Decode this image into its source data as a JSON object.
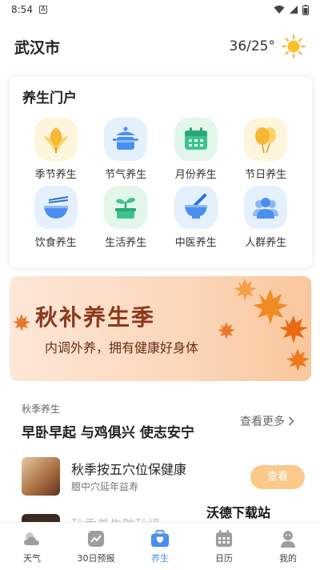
{
  "status_bar": {
    "time": "8:54",
    "notification_letter": "A"
  },
  "header": {
    "city": "武汉市",
    "temperature": "36/25°",
    "weather_icon": "sun-icon"
  },
  "portal": {
    "title": "养生门户",
    "items": [
      {
        "label": "季节养生",
        "icon": "leaf-icon",
        "bg": "#fff4dc"
      },
      {
        "label": "节气养生",
        "icon": "pot-icon",
        "bg": "#e4f0fc"
      },
      {
        "label": "月份养生",
        "icon": "calendar-icon",
        "bg": "#e2f6ec"
      },
      {
        "label": "节日养生",
        "icon": "balloons-icon",
        "bg": "#fff4dc"
      },
      {
        "label": "饮食养生",
        "icon": "bowl-icon",
        "bg": "#e4f0fc"
      },
      {
        "label": "生活养生",
        "icon": "sprout-icon",
        "bg": "#e2f6ec"
      },
      {
        "label": "中医养生",
        "icon": "mortar-icon",
        "bg": "#e4f0fc"
      },
      {
        "label": "人群养生",
        "icon": "people-icon",
        "bg": "#e4f0fc"
      }
    ]
  },
  "banner": {
    "title": "秋补养生季",
    "subtitle": "内调外养，拥有健康好身体"
  },
  "article_section": {
    "category": "秋季养生",
    "headline": "早卧早起 与鸡俱兴 使志安宁",
    "see_more": "查看更多",
    "item": {
      "title": "秋季按五穴位保健康",
      "desc": "膻中穴延年益寿",
      "button": "查看"
    },
    "peek_title": "秋季养生防秋燥"
  },
  "watermark": "沃德下载站",
  "tabs": [
    {
      "label": "天气",
      "icon": "cloud-sun-icon",
      "active": false
    },
    {
      "label": "30日预报",
      "icon": "trend-chart-icon",
      "active": false
    },
    {
      "label": "养生",
      "icon": "health-kit-icon",
      "active": true
    },
    {
      "label": "日历",
      "icon": "calendar-grid-icon",
      "active": false
    },
    {
      "label": "我的",
      "icon": "profile-icon",
      "active": false
    }
  ],
  "colors": {
    "accent": "#4a8ff0",
    "button": "#fbc98a",
    "banner_text": "#8a3a1c"
  }
}
